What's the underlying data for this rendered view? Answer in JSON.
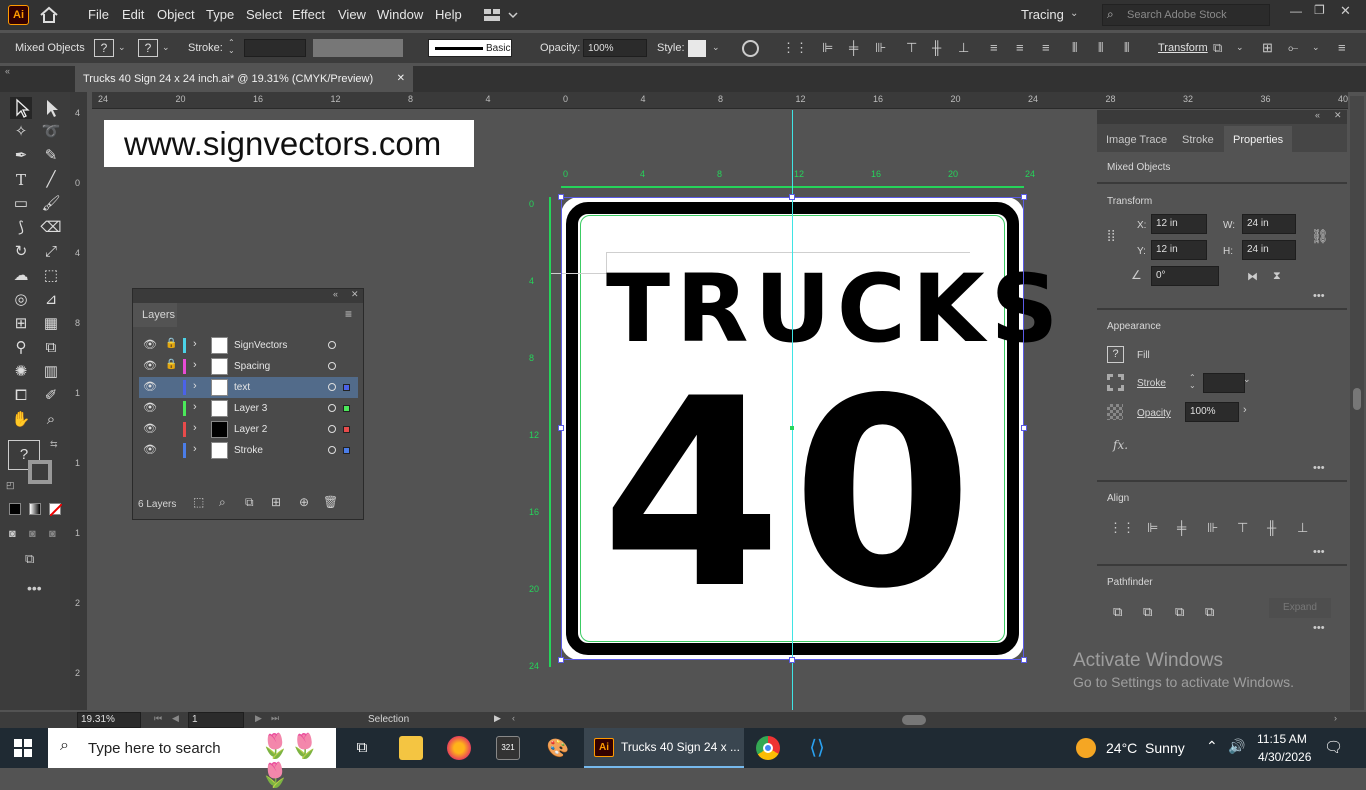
{
  "app": {
    "logo": "Ai"
  },
  "menu": [
    "File",
    "Edit",
    "Object",
    "Type",
    "Select",
    "Effect",
    "View",
    "Window",
    "Help"
  ],
  "workspace": "Tracing",
  "search_stock": {
    "placeholder": "Search Adobe Stock"
  },
  "control": {
    "selection": "Mixed Objects",
    "stroke_label": "Stroke:",
    "brush": "Basic",
    "opacity_label": "Opacity:",
    "opacity_value": "100%",
    "style_label": "Style:",
    "transform_label": "Transform"
  },
  "tab": {
    "title": "Trucks 40 Sign 24 x 24 inch.ai* @ 19.31% (CMYK/Preview)",
    "close": "✕"
  },
  "ruler_h": [
    "24",
    "20",
    "16",
    "12",
    "8",
    "4",
    "0",
    "4",
    "8",
    "12",
    "16",
    "20",
    "24",
    "28",
    "32",
    "36",
    "40"
  ],
  "ruler_v": [
    "4",
    "0",
    "4",
    "8",
    "1",
    "1",
    "1",
    "2",
    "2"
  ],
  "canvas": {
    "watermark": "www.signvectors.com",
    "sign_line1": "TRUCKS",
    "sign_line2": "40",
    "artboard_ruler_h": [
      "0",
      "4",
      "8",
      "12",
      "16",
      "20",
      "24"
    ],
    "artboard_ruler_v": [
      "0",
      "4",
      "8",
      "12",
      "16",
      "20",
      "24"
    ]
  },
  "layers": {
    "title": "Layers",
    "count": "6 Layers",
    "rows": [
      {
        "name": "SignVectors",
        "color": "#4bd3e8",
        "locked": true,
        "swatch": ""
      },
      {
        "name": "Spacing",
        "color": "#e84bd6",
        "locked": true,
        "swatch": ""
      },
      {
        "name": "text",
        "color": "#4b62e8",
        "locked": false,
        "swatch": "#4b62e8"
      },
      {
        "name": "Layer 3",
        "color": "#4be85a",
        "locked": false,
        "swatch": "#4be85a"
      },
      {
        "name": "Layer 2",
        "color": "#e84b4b",
        "locked": false,
        "swatch": "#e84b4b"
      },
      {
        "name": "Stroke",
        "color": "#4b7de8",
        "locked": false,
        "swatch": "#4b7de8"
      }
    ]
  },
  "panel": {
    "tabs": [
      "Image Trace",
      "Stroke",
      "Properties"
    ],
    "selection": "Mixed Objects",
    "transform": {
      "title": "Transform",
      "x_label": "X:",
      "x": "12 in",
      "y_label": "Y:",
      "y": "12 in",
      "w_label": "W:",
      "w": "24 in",
      "h_label": "H:",
      "h": "24 in",
      "angle": "0°"
    },
    "appearance": {
      "title": "Appearance",
      "fill": "Fill",
      "stroke": "Stroke",
      "opacity": "Opacity",
      "opacity_value": "100%",
      "fx": "fx."
    },
    "align": {
      "title": "Align"
    },
    "pathfinder": {
      "title": "Pathfinder",
      "expand": "Expand"
    }
  },
  "status": {
    "zoom": "19.31%",
    "page": "1",
    "tool": "Selection"
  },
  "activate": {
    "line1": "Activate Windows",
    "line2": "Go to Settings to activate Windows."
  },
  "taskbar": {
    "search_placeholder": "Type here to search",
    "active_app": "Trucks 40 Sign 24 x ...",
    "weather": "24°C  Sunny",
    "time": "11:15 AM",
    "date": "4/30/2026"
  }
}
